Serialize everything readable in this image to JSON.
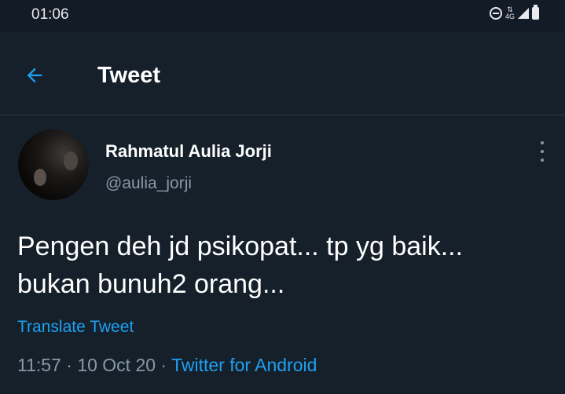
{
  "status_bar": {
    "time": "01:06",
    "network_label": "4G",
    "icons": [
      "do-not-disturb-icon",
      "network-arrows-icon",
      "signal-icon",
      "battery-icon"
    ]
  },
  "header": {
    "back_icon": "arrow-left-icon",
    "title": "Tweet"
  },
  "tweet": {
    "author": {
      "display_name": "Rahmatul Aulia Jorji",
      "handle": "@aulia_jorji"
    },
    "more_icon": "vertical-ellipsis-icon",
    "text": "Pengen deh jd psikopat... tp yg baik...\nbukan bunuh2 orang...",
    "translate_label": "Translate Tweet",
    "time": "11:57",
    "date": "10 Oct 20",
    "separator": " · ",
    "source": "Twitter for Android"
  },
  "colors": {
    "background": "#15202b",
    "accent": "#1da1f2",
    "muted": "#8899a6"
  }
}
